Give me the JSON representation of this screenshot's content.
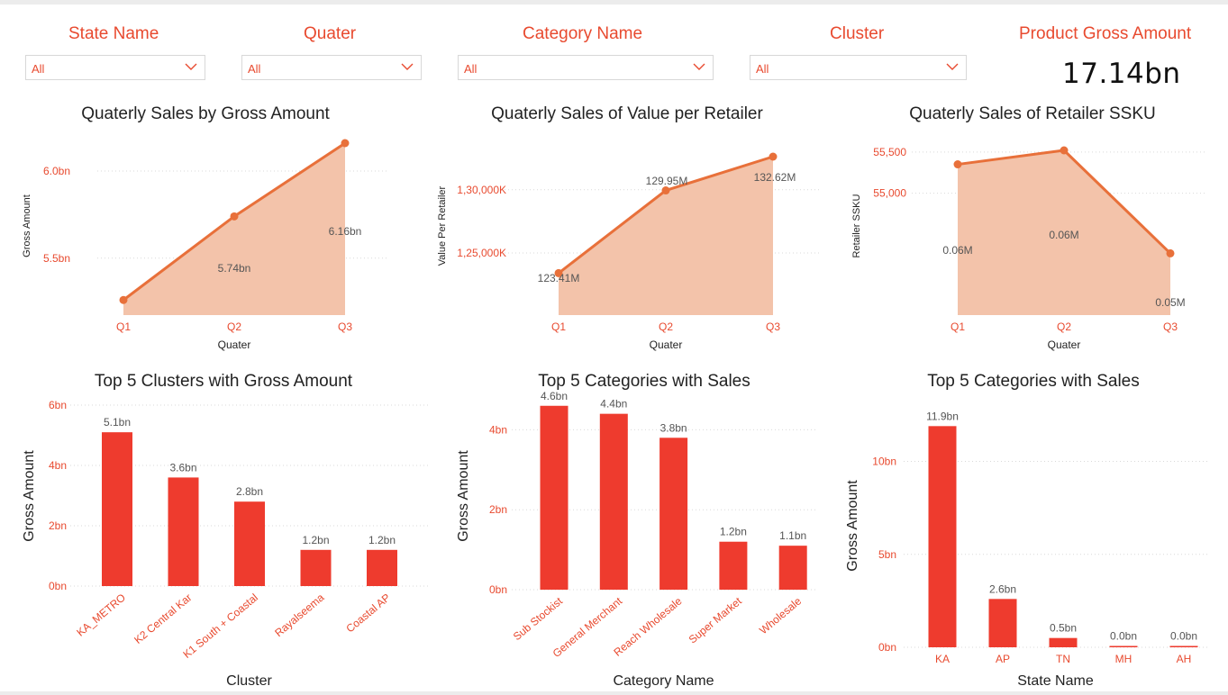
{
  "slicers": [
    {
      "title": "State Name",
      "value": "All"
    },
    {
      "title": "Quater",
      "value": "All"
    },
    {
      "title": "Category Name",
      "value": "All"
    },
    {
      "title": "Cluster",
      "value": "All"
    }
  ],
  "kpi": {
    "title": "Product Gross Amount",
    "value": "17.14bn"
  },
  "colors": {
    "accent": "#e84a2f",
    "line": "#e8703a",
    "area": "#f3c3aa",
    "bar": "#ee3b2e",
    "grid": "#d9d9d9",
    "axisText": "#e84a2f"
  },
  "chart_data": [
    {
      "type": "area",
      "title": "Quaterly Sales by Gross Amount",
      "xlabel": "Quater",
      "ylabel": "Gross Amount",
      "categories": [
        "Q1",
        "Q2",
        "Q3"
      ],
      "values": [
        5.26,
        5.74,
        6.16
      ],
      "data_labels": [
        "",
        "5.74bn",
        "6.16bn"
      ],
      "yticks": [
        {
          "value": 5.5,
          "label": "5.5bn"
        },
        {
          "value": 6.0,
          "label": "6.0bn"
        }
      ],
      "ylim": [
        5.22,
        6.16
      ]
    },
    {
      "type": "area",
      "title": "Quaterly Sales of Value per Retailer",
      "xlabel": "Quater",
      "ylabel": "Value Per Retailer",
      "categories": [
        "Q1",
        "Q2",
        "Q3"
      ],
      "values": [
        123.41,
        129.95,
        132.62
      ],
      "data_labels": [
        "123.41M",
        "129.95M",
        "132.62M"
      ],
      "yticks": [
        {
          "value": 125.0,
          "label": "1,25,000K"
        },
        {
          "value": 130.0,
          "label": "1,30,000K"
        }
      ],
      "ylim": [
        121.8,
        132.62
      ]
    },
    {
      "type": "area",
      "title": "Quaterly Sales of Retailer SSKU",
      "xlabel": "Quater",
      "ylabel": "Retailer SSKU",
      "categories": [
        "Q1",
        "Q2",
        "Q3"
      ],
      "values": [
        55350,
        55520,
        54270
      ],
      "data_labels": [
        "0.06M",
        "0.06M",
        "0.05M"
      ],
      "yticks": [
        {
          "value": 55000,
          "label": "55,000"
        },
        {
          "value": 55500,
          "label": "55,500"
        }
      ],
      "ylim": [
        53870,
        55520
      ]
    },
    {
      "type": "bar",
      "title": "Top 5 Clusters with Gross Amount",
      "xlabel": "Cluster",
      "ylabel": "Gross Amount",
      "categories": [
        "KA_METRO",
        "K2 Central Kar",
        "K1 South + Coastal",
        "Rayalseema",
        "Coastal AP"
      ],
      "values": [
        5.1,
        3.6,
        2.8,
        1.2,
        1.2
      ],
      "data_labels": [
        "5.1bn",
        "3.6bn",
        "2.8bn",
        "1.2bn",
        "1.2bn"
      ],
      "yticks": [
        {
          "value": 0,
          "label": "0bn"
        },
        {
          "value": 2,
          "label": "2bn"
        },
        {
          "value": 4,
          "label": "4bn"
        },
        {
          "value": 6,
          "label": "6bn"
        }
      ],
      "ylim": [
        0,
        6
      ]
    },
    {
      "type": "bar",
      "title": "Top 5 Categories with Sales",
      "xlabel": "Category Name",
      "ylabel": "Gross Amount",
      "categories": [
        "Sub Stockist",
        "General Merchant",
        "Reach Wholesale",
        "Super Market",
        "Wholesale"
      ],
      "values": [
        4.6,
        4.4,
        3.8,
        1.2,
        1.1
      ],
      "data_labels": [
        "4.6bn",
        "4.4bn",
        "3.8bn",
        "1.2bn",
        "1.1bn"
      ],
      "yticks": [
        {
          "value": 0,
          "label": "0bn"
        },
        {
          "value": 2,
          "label": "2bn"
        },
        {
          "value": 4,
          "label": "4bn"
        }
      ],
      "ylim": [
        0,
        5.0
      ]
    },
    {
      "type": "bar",
      "title": "Top 5 Categories with Sales",
      "xlabel": "State Name",
      "ylabel": "Gross Amount",
      "categories": [
        "KA",
        "AP",
        "TN",
        "MH",
        "AH"
      ],
      "values": [
        11.9,
        2.6,
        0.5,
        0.04,
        0.02
      ],
      "data_labels": [
        "11.9bn",
        "2.6bn",
        "0.5bn",
        "0.0bn",
        "0.0bn"
      ],
      "yticks": [
        {
          "value": 0,
          "label": "0bn"
        },
        {
          "value": 5,
          "label": "5bn"
        },
        {
          "value": 10,
          "label": "10bn"
        }
      ],
      "ylim": [
        0,
        12.4
      ]
    }
  ]
}
